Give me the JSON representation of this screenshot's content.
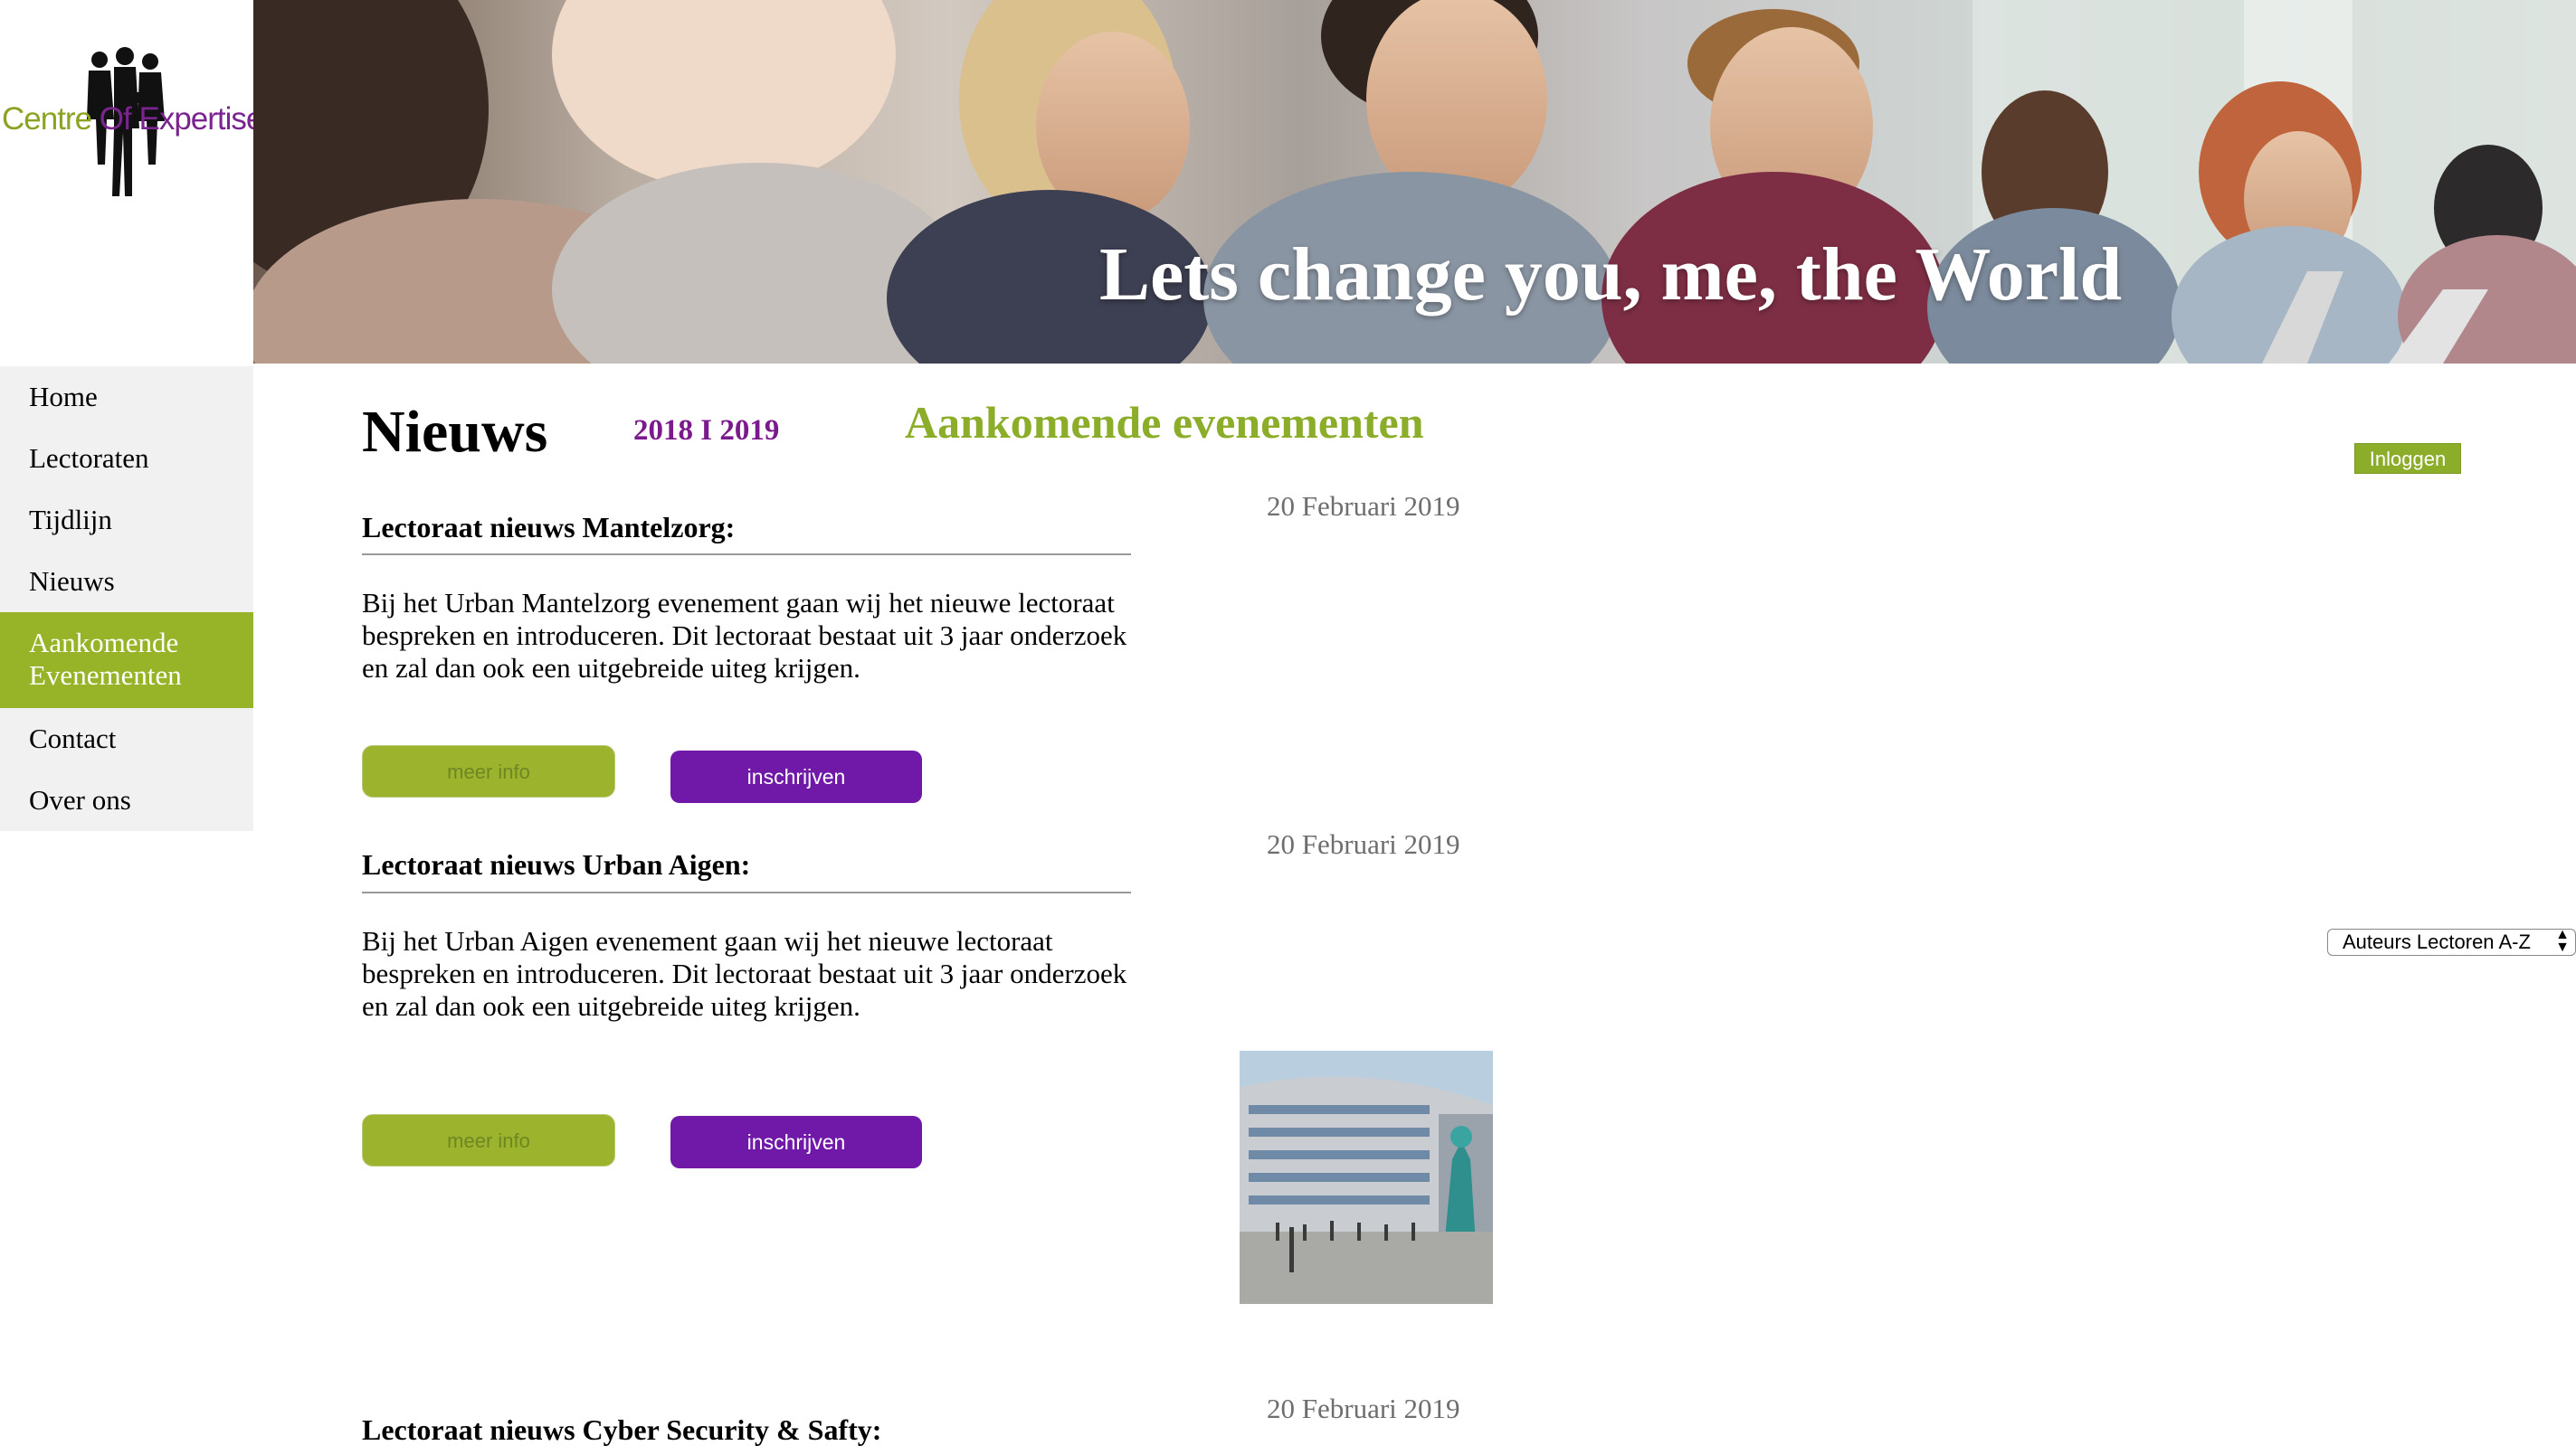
{
  "logo": {
    "word1": "Centre",
    "word2": "Of",
    "word3": "Expertise"
  },
  "hero": {
    "tagline": "Lets change you, me, the World"
  },
  "sidebar": {
    "items": [
      {
        "label": "Home"
      },
      {
        "label": "Lectoraten"
      },
      {
        "label": "Tijdlijn"
      },
      {
        "label": "Nieuws"
      },
      {
        "label": "Aankomende\nEvenementen",
        "active": true
      },
      {
        "label": "Contact"
      },
      {
        "label": "Over ons"
      }
    ]
  },
  "main": {
    "title": "Nieuws",
    "years": "2018 I 2019",
    "events_title": "Aankomende evenementen",
    "login_label": "Inloggen",
    "author_select": "Auteurs Lectoren A-Z",
    "articles": [
      {
        "title": "Lectoraat nieuws Mantelzorg:",
        "body": "Bij het Urban Mantelzorg evenement gaan wij het nieuwe lectoraat bespreken en introduceren. Dit lectoraat bestaat uit 3 jaar onderzoek en zal dan ook een uitgebreide uiteg krijgen.",
        "date": "20 Februari 2019",
        "more_label": "meer info",
        "subscribe_label": "inschrijven"
      },
      {
        "title": "Lectoraat nieuws Urban Aigen:",
        "body": "Bij het Urban Aigen evenement gaan wij het nieuwe lectoraat bespreken en introduceren. Dit lectoraat bestaat uit 3 jaar onderzoek en zal dan ook een uitgebreide uiteg krijgen.",
        "date": "20 Februari 2019",
        "more_label": "meer info",
        "subscribe_label": "inschrijven"
      },
      {
        "title": "Lectoraat nieuws Cyber Security & Safty:",
        "date": "20 Februari 2019"
      }
    ]
  },
  "colors": {
    "accent_green": "#8cad2a",
    "accent_purple": "#7019a9",
    "title_purple": "#7b1a8c"
  }
}
